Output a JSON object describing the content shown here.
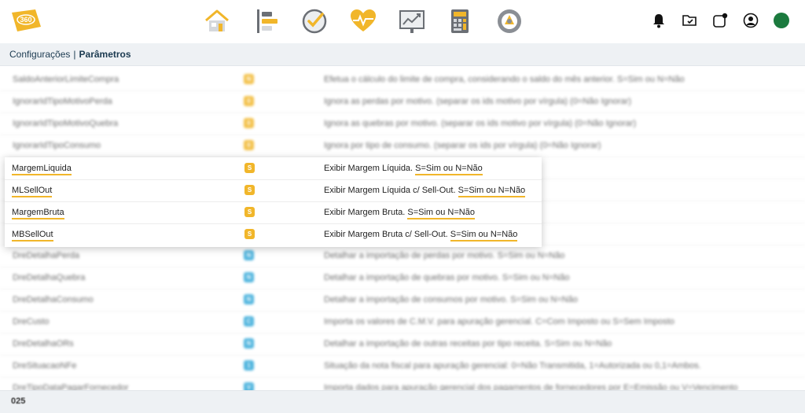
{
  "header": {
    "logo_text": "360",
    "nav_icons": [
      "home-icon",
      "hierarchy-icon",
      "check-circle-icon",
      "heart-pulse-icon",
      "chart-board-icon",
      "calculator-icon",
      "settings-gear-icon"
    ],
    "right_icons": [
      "bell-icon",
      "folder-check-icon",
      "notification-app-icon",
      "user-circle-icon"
    ],
    "status_color": "#1b7a3e"
  },
  "breadcrumb": {
    "parent": "Configurações",
    "separator": "|",
    "current": "Parâmetros"
  },
  "colors": {
    "accent": "#f1b62a",
    "info": "#2fa7d8"
  },
  "rows_top": [
    {
      "name": "SaldoAnteriorLimiteCompra",
      "value": "N",
      "desc": "Efetua o cálculo do limite de compra, considerando o saldo do mês anterior. S=Sim ou N=Não"
    },
    {
      "name": "IgnorarIdTipoMotivoPerda",
      "value": "0",
      "desc": "Ignora as perdas por motivo. (separar os ids motivo por vírgula) (0=Não Ignorar)"
    },
    {
      "name": "IgnorarIdTipoMotivoQuebra",
      "value": "0",
      "desc": "Ignora as quebras por motivo. (separar os ids motivo por vírgula) (0=Não Ignorar)"
    },
    {
      "name": "IgnorarIdTipoConsumo",
      "value": "0",
      "desc": "Ignora por tipo de consumo. (separar os ids por vírgula) (0=Não Ignorar)"
    }
  ],
  "rows_focus": [
    {
      "name": "MargemLiquida",
      "value": "S",
      "desc_prefix": "Exibir Margem Líquida. ",
      "desc_highlight": "S=Sim ou N=Não"
    },
    {
      "name": "MLSellOut",
      "value": "S",
      "desc_prefix": "Exibir Margem Líquida c/ Sell-Out. ",
      "desc_highlight": "S=Sim ou N=Não"
    },
    {
      "name": "MargemBruta",
      "value": "S",
      "desc_prefix": "Exibir Margem Bruta. ",
      "desc_highlight": "S=Sim ou N=Não"
    },
    {
      "name": "MBSellOut",
      "value": "S",
      "desc_prefix": "Exibir Margem Bruta c/ Sell-Out. ",
      "desc_highlight": "S=Sim ou N=Não"
    }
  ],
  "rows_bottom": [
    {
      "name": "DreDetalhaPerda",
      "value": "N",
      "desc": "Detalhar a importação de perdas por motivo. S=Sim ou N=Não"
    },
    {
      "name": "DreDetalhaQuebra",
      "value": "N",
      "desc": "Detalhar a importação de quebras por motivo. S=Sim ou N=Não"
    },
    {
      "name": "DreDetalhaConsumo",
      "value": "N",
      "desc": "Detalhar a importação de consumos por motivo. S=Sim ou N=Não"
    },
    {
      "name": "DreCusto",
      "value": "C",
      "desc": "Importa os valores de C.M.V. para apuração gerencial. C=Com Imposto ou S=Sem Imposto"
    },
    {
      "name": "DreDetalhaORs",
      "value": "N",
      "desc": "Detalhar a importação de outras receitas por tipo receita. S=Sim ou N=Não"
    },
    {
      "name": "DreSituacaoNFe",
      "value": "1",
      "desc": "Situação da nota fiscal para apuração gerencial: 0=Não Transmitida, 1=Autorizada ou 0,1=Ambos."
    },
    {
      "name": "DreTipoDataPagarFornecedor",
      "value": "V",
      "desc": "Importa dados para apuração gerencial dos pagamentos de fornecedores por E=Emissão ou V=Vencimento"
    }
  ],
  "footer": {
    "count": "025"
  }
}
